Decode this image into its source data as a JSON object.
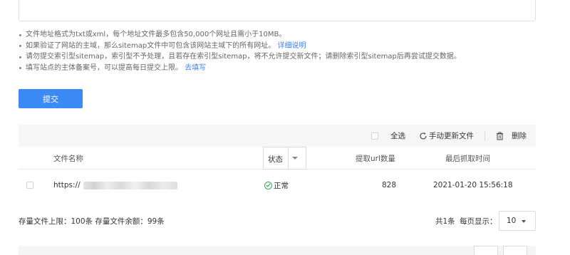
{
  "notes": [
    {
      "text": "文件地址格式为txt或xml，每个地址文件最多包含50,000个网址且需小于10MB。",
      "link": ""
    },
    {
      "text": "如果验证了网站的主域，那么sitemap文件中可包含该网站主域下的所有网址。",
      "link": "详细说明"
    },
    {
      "text": "请勿提交索引型sitemap，索引型不予处理，且若存在索引型sitemap，将不允许提交新文件；请删除索引型sitemap后再尝试提交数据。",
      "link": ""
    },
    {
      "text": "填写站点的主体备案号，可以提高每日提交上限。",
      "link": "去填写"
    }
  ],
  "submit_label": "提交",
  "toolbar": {
    "select_all_label": "全选",
    "manual_update_label": "手动更新文件",
    "delete_label": "删除"
  },
  "table": {
    "columns": {
      "file_name": "文件名称",
      "status": "状态",
      "url_count": "提取url数量",
      "last_fetch": "最后抓取时间"
    },
    "rows": [
      {
        "file_name": "https://",
        "status": "正常",
        "url_count": "828",
        "last_fetch": "2021-01-20 15:56:18"
      }
    ]
  },
  "footer": {
    "quota_text": "存量文件上限：100条  存量文件余额：99条",
    "total_text": "共1条",
    "per_page_label": "每页显示：",
    "per_page_value": "10"
  },
  "colors": {
    "accent": "#3c8af5",
    "link": "#3d7ff4",
    "ok": "#3aa757"
  }
}
